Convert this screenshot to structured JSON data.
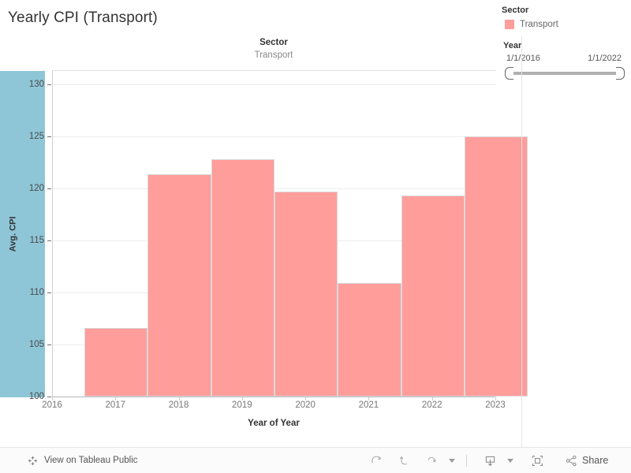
{
  "dashboard": {
    "title": "Yearly CPI (Transport)"
  },
  "legend": {
    "caption": "Sector",
    "items": [
      {
        "label": "Transport",
        "color": "#ff9d9b"
      }
    ]
  },
  "year_filter": {
    "caption": "Year",
    "min_label": "1/1/2016",
    "max_label": "1/1/2022"
  },
  "column_header": {
    "field": "Sector",
    "member": "Transport"
  },
  "toolbar": {
    "view_link": "View on Tableau Public",
    "share_label": "Share",
    "icons": {
      "tableau_logo": "tableau-logo-icon",
      "redo": "redo-icon",
      "undo": "undo-icon",
      "revert": "revert-icon",
      "revert_caret": "chevron-down-icon",
      "download": "download-icon",
      "download_caret": "chevron-down-icon",
      "fullscreen": "fullscreen-icon",
      "share": "share-icon"
    }
  },
  "chart_data": {
    "type": "bar",
    "title": "Yearly CPI (Transport)",
    "xlabel": "Year of Year",
    "ylabel": "Avg. CPI",
    "categories": [
      "2016",
      "2017",
      "2018",
      "2019",
      "2020",
      "2021",
      "2022"
    ],
    "x_tick_labels": [
      "2016",
      "2017",
      "2018",
      "2019",
      "2020",
      "2021",
      "2022",
      "2023"
    ],
    "values": [
      106.6,
      121.4,
      122.8,
      119.7,
      110.9,
      119.3,
      125.0
    ],
    "series": [
      {
        "name": "Transport",
        "color": "#ff9d9b",
        "values": [
          106.6,
          121.4,
          122.8,
          119.7,
          110.9,
          119.3,
          125.0
        ]
      }
    ],
    "ylim": [
      100,
      131.3
    ],
    "y_tick_labels": [
      "100",
      "105",
      "110",
      "115",
      "120",
      "125",
      "130"
    ],
    "y_ticks": [
      100,
      105,
      110,
      115,
      120,
      125,
      130
    ],
    "grid": true,
    "legend_position": "right"
  }
}
